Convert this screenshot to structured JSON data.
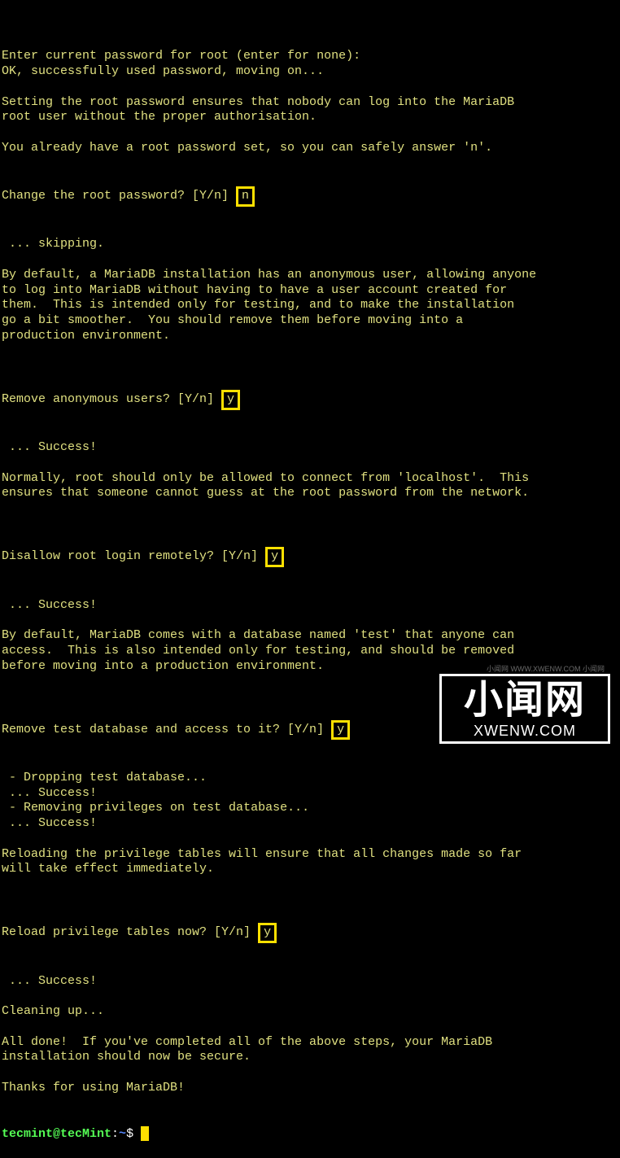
{
  "lines": [
    "",
    "Enter current password for root (enter for none):",
    "OK, successfully used password, moving on...",
    "",
    "Setting the root password ensures that nobody can log into the MariaDB",
    "root user without the proper authorisation.",
    "",
    "You already have a root password set, so you can safely answer 'n'."
  ],
  "q1_prompt": "Change the root password? [Y/n] ",
  "q1_answer": "n",
  "q1_after": [
    " ... skipping.",
    "",
    "By default, a MariaDB installation has an anonymous user, allowing anyone",
    "to log into MariaDB without having to have a user account created for",
    "them.  This is intended only for testing, and to make the installation",
    "go a bit smoother.  You should remove them before moving into a",
    "production environment.",
    ""
  ],
  "q2_prompt": "Remove anonymous users? [Y/n] ",
  "q2_answer": "y",
  "q2_after": [
    " ... Success!",
    "",
    "Normally, root should only be allowed to connect from 'localhost'.  This",
    "ensures that someone cannot guess at the root password from the network.",
    ""
  ],
  "q3_prompt": "Disallow root login remotely? [Y/n] ",
  "q3_answer": "y",
  "q3_after": [
    " ... Success!",
    "",
    "By default, MariaDB comes with a database named 'test' that anyone can",
    "access.  This is also intended only for testing, and should be removed",
    "before moving into a production environment.",
    ""
  ],
  "q4_prompt": "Remove test database and access to it? [Y/n] ",
  "q4_answer": "y",
  "q4_after": [
    " - Dropping test database...",
    " ... Success!",
    " - Removing privileges on test database...",
    " ... Success!",
    "",
    "Reloading the privilege tables will ensure that all changes made so far",
    "will take effect immediately.",
    ""
  ],
  "q5_prompt": "Reload privilege tables now? [Y/n] ",
  "q5_answer": "y",
  "q5_after": [
    " ... Success!",
    "",
    "Cleaning up...",
    "",
    "All done!  If you've completed all of the above steps, your MariaDB",
    "installation should now be secure.",
    "",
    "Thanks for using MariaDB!"
  ],
  "prompt": {
    "user": "tecmint@tecMint",
    "sep": ":",
    "path": "~",
    "dollar": "$ "
  },
  "watermark": {
    "big": "小闻网",
    "small": "XWENW.COM",
    "tiny": "小闻网 WWW.XWENW.COM 小闻网"
  }
}
